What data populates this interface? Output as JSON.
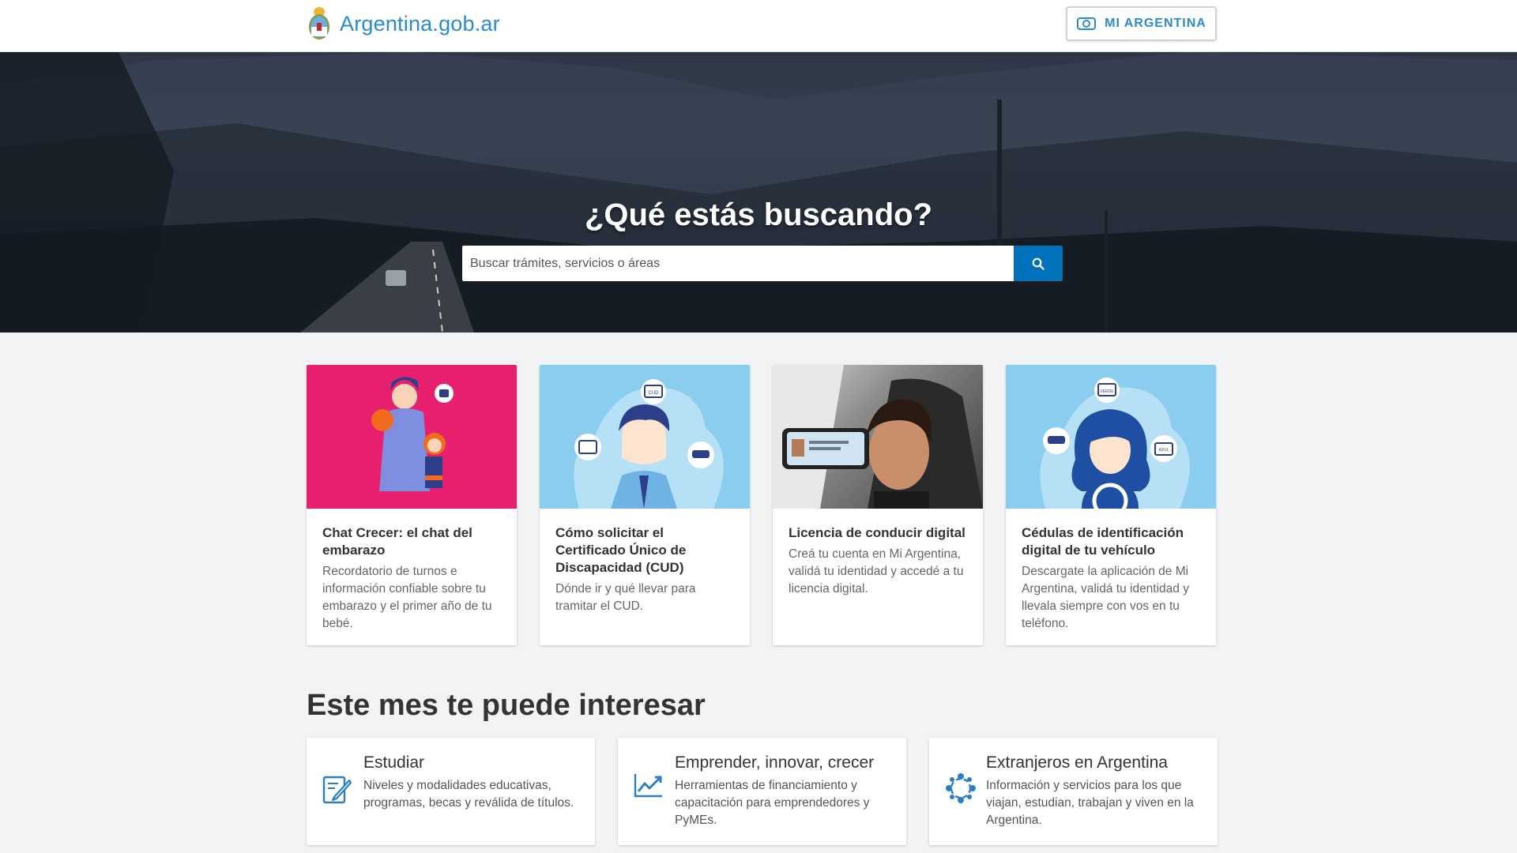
{
  "header": {
    "logo_text": "Argentina.gob.ar",
    "mi_argentina_label": "MI ARGENTINA"
  },
  "hero": {
    "title": "¿Qué estás buscando?",
    "search_placeholder": "Buscar trámites, servicios o áreas",
    "search_icon": "search-icon"
  },
  "cards": [
    {
      "title": "Chat Crecer: el chat del embarazo",
      "text": "Recordatorio de turnos e información confiable sobre tu embarazo y el primer año de tu bebé."
    },
    {
      "title": "Cómo solicitar el Certificado Único de Discapacidad (CUD)",
      "text": "Dónde ir y qué llevar para tramitar el CUD."
    },
    {
      "title": "Licencia de conducir digital",
      "text": "Creá tu cuenta en Mi Argentina, validá tu identidad y accedé a tu licencia digital."
    },
    {
      "title": "Cédulas de identificación digital de tu vehículo",
      "text": "Descargate la aplicación de Mi Argentina, validá tu identidad y llevala siempre con vos en tu teléfono."
    }
  ],
  "card_labels": {
    "cud": "CUD",
    "verde": "VERDE",
    "azul": "AZUL"
  },
  "section": {
    "title": "Este mes te puede interesar"
  },
  "features": [
    {
      "title": "Estudiar",
      "text": "Niveles y modalidades educativas, programas, becas y reválida de títulos.",
      "icon": "edit-document-icon"
    },
    {
      "title": "Emprender, innovar, crecer",
      "text": "Herramientas de financiamiento y capacitación para emprendedores y PyMEs.",
      "icon": "trending-up-icon"
    },
    {
      "title": "Extranjeros en Argentina",
      "text": "Información y servicios para los que viajan, estudian, trabajan y viven en la Argentina.",
      "icon": "network-icon"
    }
  ],
  "colors": {
    "brand_blue": "#2a8ad4",
    "search_button": "#0072bb",
    "card1_bg": "#e6206f",
    "card_light_blue": "#8acdee"
  }
}
